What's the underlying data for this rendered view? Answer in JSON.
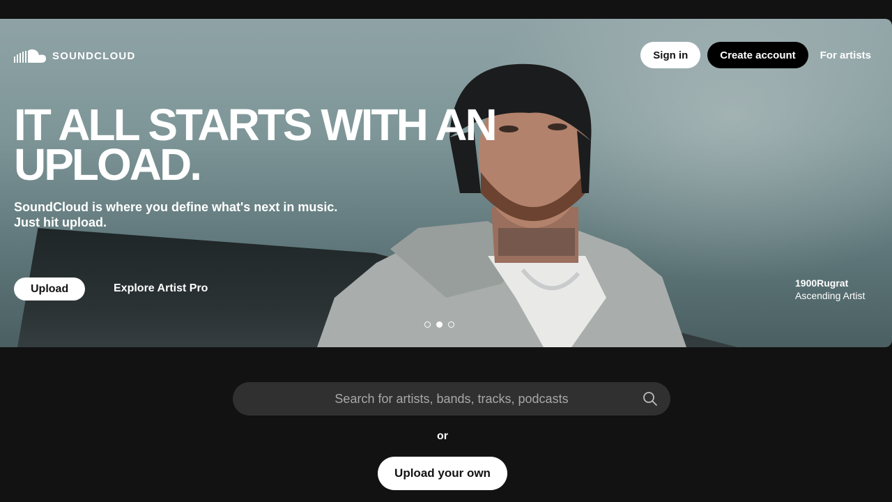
{
  "brand": {
    "logo_text": "SOUNDCLOUD"
  },
  "nav": {
    "sign_in": "Sign in",
    "create_account": "Create account",
    "for_artists": "For artists"
  },
  "hero": {
    "headline": "IT ALL STARTS WITH AN UPLOAD.",
    "subline_1": "SoundCloud is where you define what's next in music.",
    "subline_2": "Just hit upload.",
    "upload_button": "Upload",
    "explore_link": "Explore Artist Pro",
    "carousel": {
      "count": 3,
      "active_index": 1
    },
    "credit": {
      "artist": "1900Rugrat",
      "caption": "Ascending Artist"
    }
  },
  "search": {
    "placeholder": "Search for artists, bands, tracks, podcasts"
  },
  "or_text": "or",
  "upload_own": "Upload your own",
  "colors": {
    "background": "#121212",
    "search_bg": "#303030",
    "button_light": "#ffffff",
    "button_dark": "#000000"
  },
  "icons": [
    "soundcloud-logo-icon",
    "search-icon"
  ]
}
